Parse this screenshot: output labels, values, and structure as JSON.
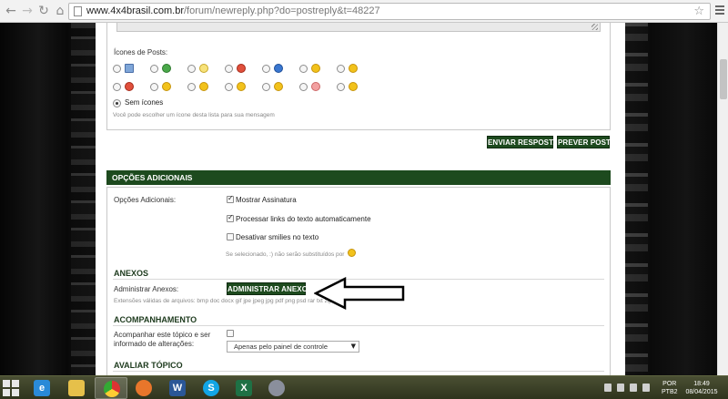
{
  "browser": {
    "url_host": "www.4x4brasil.com.br",
    "url_path": "/forum/newreply.php?do=postreply&t=48227"
  },
  "post_icons": {
    "label": "Ícones de Posts:",
    "row1": [
      "post-doc",
      "smile-green",
      "lightbulb",
      "mad",
      "question",
      "cool",
      "smile"
    ],
    "row2": [
      "angry",
      "grin",
      "tongue",
      "frown",
      "embarrassed",
      "redface",
      "thumbs-up"
    ],
    "none_label": "Sem ícones",
    "hint": "Você pode escolher um ícone desta lista para sua mensagem"
  },
  "buttons": {
    "send": "ENVIAR RESPOSTA",
    "preview": "PREVER POST"
  },
  "additional_options": {
    "section_title": "OPÇÕES ADICIONAIS",
    "label": "Opções Adicionais:",
    "options": [
      {
        "label": "Mostrar Assinatura",
        "checked": true
      },
      {
        "label": "Processar links do texto automaticamente",
        "checked": true
      },
      {
        "label": "Desativar smilies no texto",
        "checked": false
      }
    ],
    "smilies_hint": "Se selecionado, :) não serão substituídos por"
  },
  "attachments": {
    "title": "ANEXOS",
    "label": "Administrar Anexos:",
    "button": "ADMINISTRAR ANEXOS",
    "extensions": "Extensões válidas de arquivos: bmp doc docx gif jpe jpeg jpg pdf png psd rar txt zip"
  },
  "tracking": {
    "title": "ACOMPANHAMENTO",
    "label_line1": "Acompanhar este tópico e ser",
    "label_line2": "informado de alterações:",
    "checked": false,
    "select_value": "Apenas pelo painel de controle"
  },
  "rating": {
    "title": "AVALIAR TÓPICO"
  },
  "taskbar": {
    "apps": [
      "internet-explorer",
      "file-explorer",
      "chrome",
      "firefox",
      "word",
      "skype",
      "excel",
      "paint"
    ],
    "lang_line1": "POR",
    "lang_line2": "PTB2",
    "time": "18:49",
    "date": "08/04/2015"
  },
  "colors": {
    "accent_green": "#1d4a1e",
    "header_text": "#1d3a1d"
  }
}
